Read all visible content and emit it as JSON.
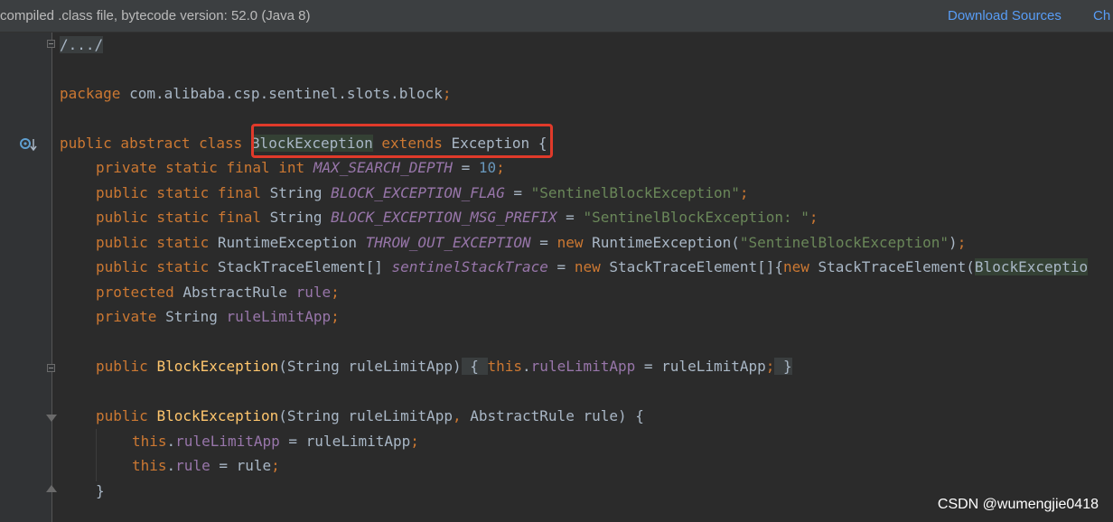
{
  "banner": {
    "text": "compiled .class file, bytecode version: 52.0 (Java 8)",
    "download_sources": "Download Sources",
    "choose_sources": "Ch"
  },
  "code": {
    "l1": {
      "fold": "/.../"
    },
    "l2": {
      "kw": "package",
      "pkg": " com.alibaba.csp.sentinel.slots.block",
      "semi": ";"
    },
    "l3": {
      "kw": "public abstract class ",
      "cls": "BlockException",
      "ext": " extends ",
      "sup": "Exception",
      "brace": " {"
    },
    "l4": {
      "kw": "private static final int ",
      "name": "MAX_SEARCH_DEPTH",
      "eq": " = ",
      "num": "10",
      "semi": ";"
    },
    "l5": {
      "kw": "public static final ",
      "type": "String ",
      "name": "BLOCK_EXCEPTION_FLAG",
      "eq": " = ",
      "str": "\"SentinelBlockException\"",
      "semi": ";"
    },
    "l6": {
      "kw": "public static final ",
      "type": "String ",
      "name": "BLOCK_EXCEPTION_MSG_PREFIX",
      "eq": " = ",
      "str": "\"SentinelBlockException: \"",
      "semi": ";"
    },
    "l7": {
      "kw": "public static ",
      "type": "RuntimeException ",
      "name": "THROW_OUT_EXCEPTION",
      "eq": " = ",
      "kw2": "new ",
      "call": "RuntimeException(",
      "str": "\"SentinelBlockException\"",
      "close": ")",
      "semi": ";"
    },
    "l8": {
      "kw": "public static ",
      "type": "StackTraceElement[] ",
      "name": "sentinelStackTrace",
      "eq": " = ",
      "kw2": "new ",
      "call": "StackTraceElement[]{",
      "kw3": "new ",
      "call2": "StackTraceElement(",
      "arg": "BlockExceptio"
    },
    "l9": {
      "kw": "protected ",
      "type": "AbstractRule ",
      "name": "rule",
      "semi": ";"
    },
    "l10": {
      "kw": "private ",
      "type": "String ",
      "name": "ruleLimitApp",
      "semi": ";"
    },
    "l11": {
      "kw": "public ",
      "mth": "BlockException",
      "params": "(String ruleLimitApp)",
      "ph_open": " { ",
      "kw2": "this",
      "dot": ".",
      "fld": "ruleLimitApp",
      "rest": " = ruleLimitApp",
      "semi": ";",
      "ph_close": " }"
    },
    "l12": {
      "kw": "public ",
      "mth": "BlockException",
      "p1": "(String ruleLimitApp",
      "comma": ",",
      "p2": " AbstractRule rule) {"
    },
    "l13": {
      "kw": "this",
      "dot": ".",
      "fld": "ruleLimitApp",
      "rest": " = ruleLimitApp",
      "semi": ";"
    },
    "l14": {
      "kw": "this",
      "dot": ".",
      "fld": "rule",
      "rest": " = rule",
      "semi": ";"
    },
    "l15": {
      "brace": "}"
    }
  },
  "watermark": "CSDN @wumengjie0418",
  "colors": {
    "background": "#2b2b2b",
    "keyword": "#cc7832",
    "string": "#6a8759",
    "field": "#9876aa",
    "number": "#6897bb",
    "method": "#ffc66d",
    "link": "#589df6",
    "highlight_box": "#e03a2a"
  }
}
